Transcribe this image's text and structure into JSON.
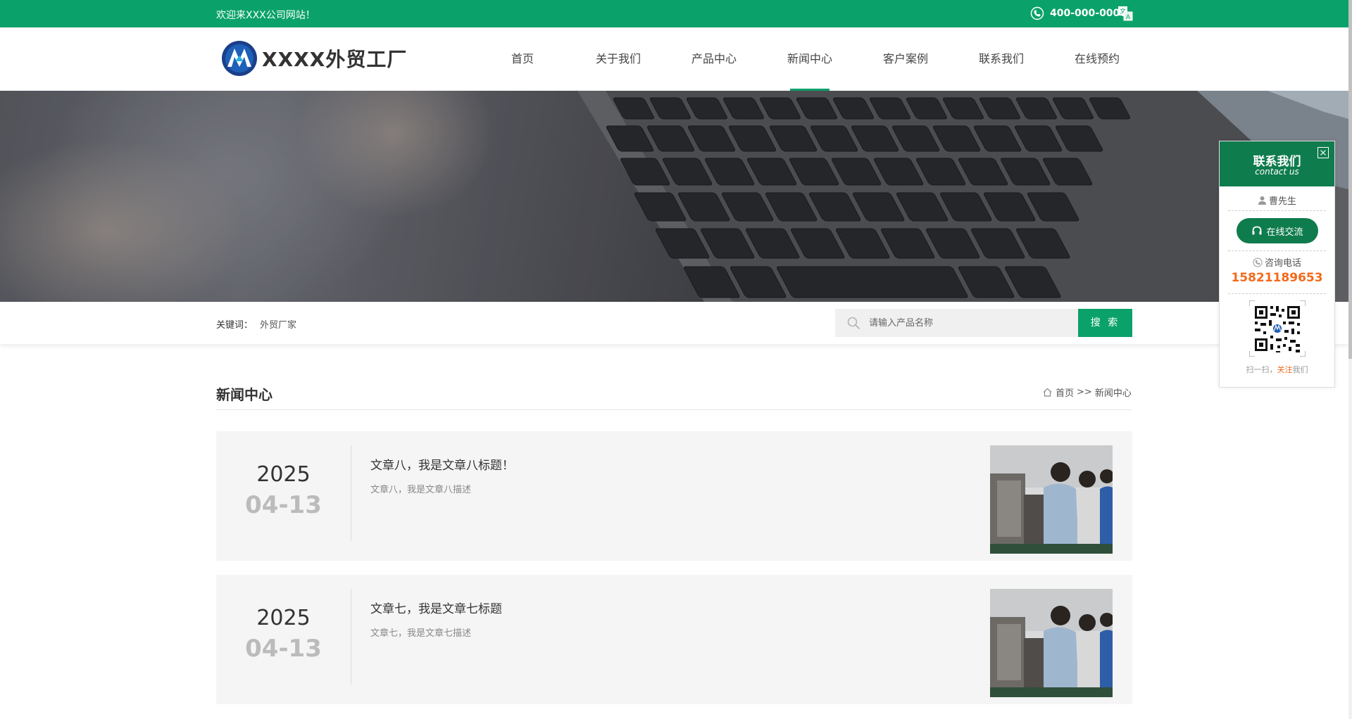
{
  "topbar": {
    "welcome": "欢迎来XXX公司网站！",
    "phone": "400-000-0000"
  },
  "header": {
    "logo_text": "XXXX外贸工厂",
    "nav": [
      {
        "label": "首页"
      },
      {
        "label": "关于我们"
      },
      {
        "label": "产品中心"
      },
      {
        "label": "新闻中心",
        "active": true
      },
      {
        "label": "客户案例"
      },
      {
        "label": "联系我们"
      },
      {
        "label": "在线预约"
      }
    ]
  },
  "search": {
    "keywords_label": "关键词：",
    "keywords_value": "外贸厂家",
    "placeholder": "请输入产品名称",
    "button": "搜 索"
  },
  "section": {
    "title": "新闻中心",
    "breadcrumb_home": "首页",
    "breadcrumb_sep": ">>",
    "breadcrumb_current": "新闻中心"
  },
  "news": [
    {
      "year": "2025",
      "md": "04-13",
      "title": "文章八，我是文章八标题！",
      "desc": "文章八，我是文章八描述"
    },
    {
      "year": "2025",
      "md": "04-13",
      "title": "文章七，我是文章七标题",
      "desc": "文章七，我是文章七描述"
    }
  ],
  "contact": {
    "title": "联系我们",
    "subtitle": "contact us",
    "person": "曹先生",
    "chat": "在线交流",
    "tel_label": "咨询电话",
    "tel": "15821189653",
    "scan_pre": "扫一扫，",
    "scan_hl": "关注",
    "scan_post": "我们"
  },
  "colors": {
    "brand_green": "#0aa26a",
    "panel_green": "#0f7c4d",
    "accent_orange": "#f26a1b"
  }
}
